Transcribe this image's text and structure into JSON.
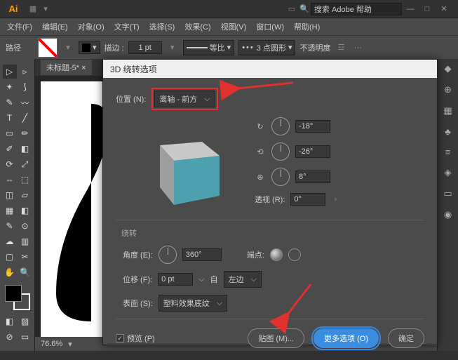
{
  "titlebar": {
    "search_placeholder": "搜索 Adobe 帮助"
  },
  "menus": {
    "file": "文件(F)",
    "edit": "编辑(E)",
    "object": "对象(O)",
    "type": "文字(T)",
    "select": "选择(S)",
    "effect": "效果(C)",
    "view": "视图(V)",
    "window": "窗口(W)",
    "help": "帮助(H)"
  },
  "optbar": {
    "path_label": "路径",
    "stroke_label": "描边 :",
    "stroke_val": "1 pt",
    "uniform": "等比",
    "dash": "3 点圆形",
    "opacity": "不透明度"
  },
  "doc": {
    "tab": "未标题-5* ",
    "zoom": "76.6%"
  },
  "dialog": {
    "title": "3D 绕转选项",
    "pos_label": "位置 (N):",
    "pos_value": "离轴 - 前方",
    "rot": {
      "x": "-18°",
      "y": "-26°",
      "z": "8°"
    },
    "persp_label": "透视 (R):",
    "persp_val": "0°",
    "sect_rev": "绕转",
    "angle_label": "角度 (E):",
    "angle_val": "360°",
    "cap_label": "端点:",
    "offset_label": "位移 (F):",
    "offset_val": "0 pt",
    "offset_from": "自",
    "offset_edge": "左边",
    "surface_label": "表面 (S):",
    "surface_val": "塑料效果底纹",
    "preview": "预览 (P)",
    "map_art": "贴图 (M)...",
    "more": "更多选项 (O)",
    "ok": "确定"
  }
}
